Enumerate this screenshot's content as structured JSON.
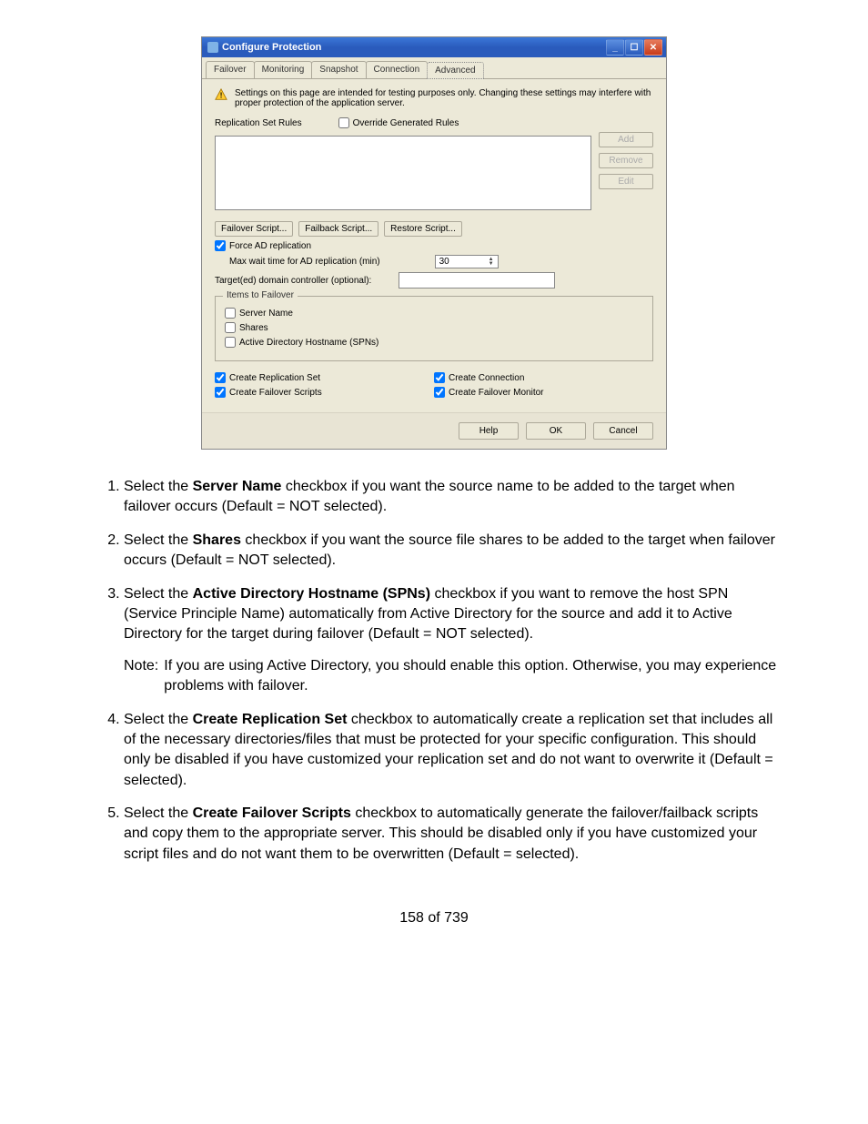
{
  "dialog": {
    "title": "Configure Protection",
    "tabs": [
      "Failover",
      "Monitoring",
      "Snapshot",
      "Connection",
      "Advanced"
    ],
    "active_tab": "Advanced",
    "warning_text": "Settings on this page are intended for testing purposes only.  Changing these settings may interfere with proper protection of the application server.",
    "repl_rules_label": "Replication Set Rules",
    "override_label": "Override Generated Rules",
    "side_buttons": {
      "add": "Add",
      "remove": "Remove",
      "edit": "Edit"
    },
    "script_buttons": {
      "failover": "Failover Script...",
      "failback": "Failback Script...",
      "restore": "Restore Script..."
    },
    "force_ad_label": "Force AD replication",
    "max_wait_label": "Max wait time for AD replication (min)",
    "max_wait_value": "30",
    "target_dc_label": "Target(ed) domain controller (optional):",
    "items_group_title": "Items to Failover",
    "items": {
      "server_name": "Server Name",
      "shares": "Shares",
      "ad_spn": "Active Directory Hostname (SPNs)"
    },
    "create_repl_set": "Create Replication Set",
    "create_connection": "Create Connection",
    "create_failover_scripts": "Create Failover Scripts",
    "create_failover_monitor": "Create Failover Monitor",
    "bottom_buttons": {
      "help": "Help",
      "ok": "OK",
      "cancel": "Cancel"
    }
  },
  "doc": {
    "items": [
      {
        "pre": "Select the ",
        "bold": "Server Name",
        "post": " checkbox if you want the source name to be added to the target when failover occurs (Default = NOT selected)."
      },
      {
        "pre": "Select the ",
        "bold": "Shares",
        "post": " checkbox if you want the source file shares to be added to the target when failover occurs (Default = NOT selected)."
      },
      {
        "pre": "Select the ",
        "bold": "Active Directory Hostname (SPNs)",
        "post": " checkbox if you want to remove the host SPN (Service Principle Name) automatically from Active Directory for the source and add it to Active Directory for the target during failover (Default = NOT selected)."
      },
      {
        "pre": "Select the ",
        "bold": "Create Replication Set",
        "post": " checkbox to automatically create a replication set that includes all of the necessary directories/files that must be protected for your specific configuration. This should only be disabled if you have customized your replication set and do not want to overwrite it (Default = selected)."
      },
      {
        "pre": "Select the ",
        "bold": "Create Failover Scripts",
        "post": " checkbox to automatically generate the failover/failback scripts and copy them to the appropriate server. This should be disabled only if you have customized your script files and do not want them to be overwritten (Default = selected)."
      }
    ],
    "note_label": "Note:",
    "note_text": "If you are using Active Directory, you should enable this option. Otherwise, you may experience problems with failover.",
    "page_number": "158 of 739"
  }
}
